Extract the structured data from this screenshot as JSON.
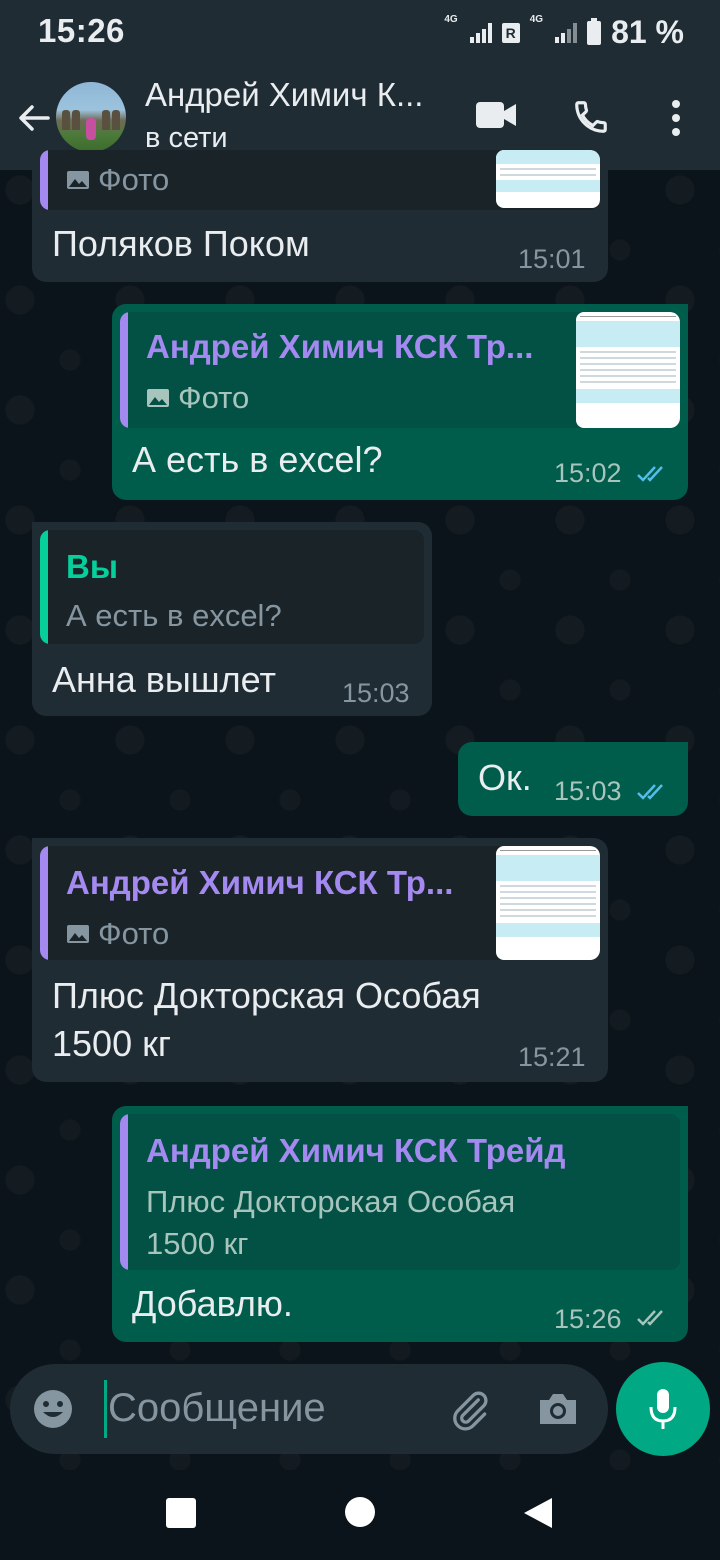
{
  "status_bar": {
    "time": "15:26",
    "net1": "4G",
    "roaming": "R",
    "net2": "4G",
    "battery": "81 %"
  },
  "header": {
    "contact_name": "Андрей Химич К...",
    "presence": "в сети"
  },
  "messages": [
    {
      "side": "in",
      "quote_sub": "Фото",
      "text": "Поляков Поком",
      "time": "15:01"
    },
    {
      "side": "out",
      "quote_name": "Андрей Химич КСК Тр...",
      "quote_sub": "Фото",
      "text": "А есть в excel?",
      "time": "15:02",
      "status": "read"
    },
    {
      "side": "in",
      "quote_name": "Вы",
      "quote_sub": "А есть в excel?",
      "text": "Анна вышлет",
      "time": "15:03"
    },
    {
      "side": "out",
      "text": "Ок.",
      "time": "15:03",
      "status": "read"
    },
    {
      "side": "in",
      "quote_name": "Андрей Химич КСК Тр...",
      "quote_sub": "Фото",
      "text_line1": "Плюс Докторская Особая",
      "text_line2": "1500 кг",
      "time": "15:21"
    },
    {
      "side": "out",
      "quote_name": "Андрей Химич КСК Трейд",
      "quote_line1": "Плюс Докторская Особая",
      "quote_line2": "1500 кг",
      "text": "Добавлю.",
      "time": "15:26",
      "status": "delivered"
    }
  ],
  "composer": {
    "placeholder": "Сообщение"
  },
  "colors": {
    "accent": "#00a884",
    "quote_purple": "#a489f0",
    "quote_green": "#06cf9c",
    "tick_read": "#53bdeb"
  }
}
